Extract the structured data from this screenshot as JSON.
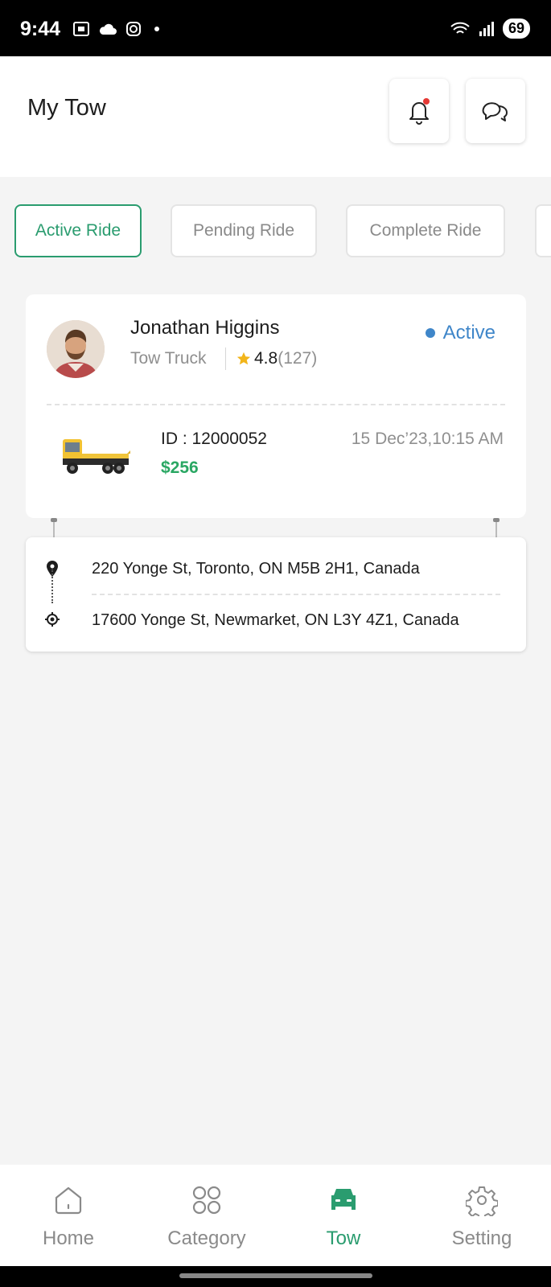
{
  "status_bar": {
    "time": "9:44",
    "battery": "69"
  },
  "header": {
    "title": "My Tow"
  },
  "tabs": [
    {
      "label": "Active Ride",
      "active": true
    },
    {
      "label": "Pending Ride",
      "active": false
    },
    {
      "label": "Complete Ride",
      "active": false
    }
  ],
  "ride": {
    "driver_name": "Jonathan Higgins",
    "vehicle_type": "Tow Truck",
    "rating": "4.8",
    "rating_count": "(127)",
    "status": "Active",
    "id_label": "ID : 12000052",
    "price": "$256",
    "datetime": "15 Dec’23,10:15 AM"
  },
  "route": {
    "pickup": "220 Yonge St, Toronto, ON M5B 2H1, Canada",
    "dropoff": "17600 Yonge St, Newmarket, ON L3Y 4Z1, Canada"
  },
  "bottom_nav": [
    {
      "label": "Home",
      "icon": "home-icon"
    },
    {
      "label": "Category",
      "icon": "category-icon"
    },
    {
      "label": "Tow",
      "icon": "car-icon",
      "active": true
    },
    {
      "label": "Setting",
      "icon": "gear-icon"
    }
  ],
  "colors": {
    "accent": "#2a9c6f",
    "status_active": "#3f86c9",
    "price": "#2aa763",
    "star": "#f2b51a",
    "notification_dot": "#e53935"
  }
}
